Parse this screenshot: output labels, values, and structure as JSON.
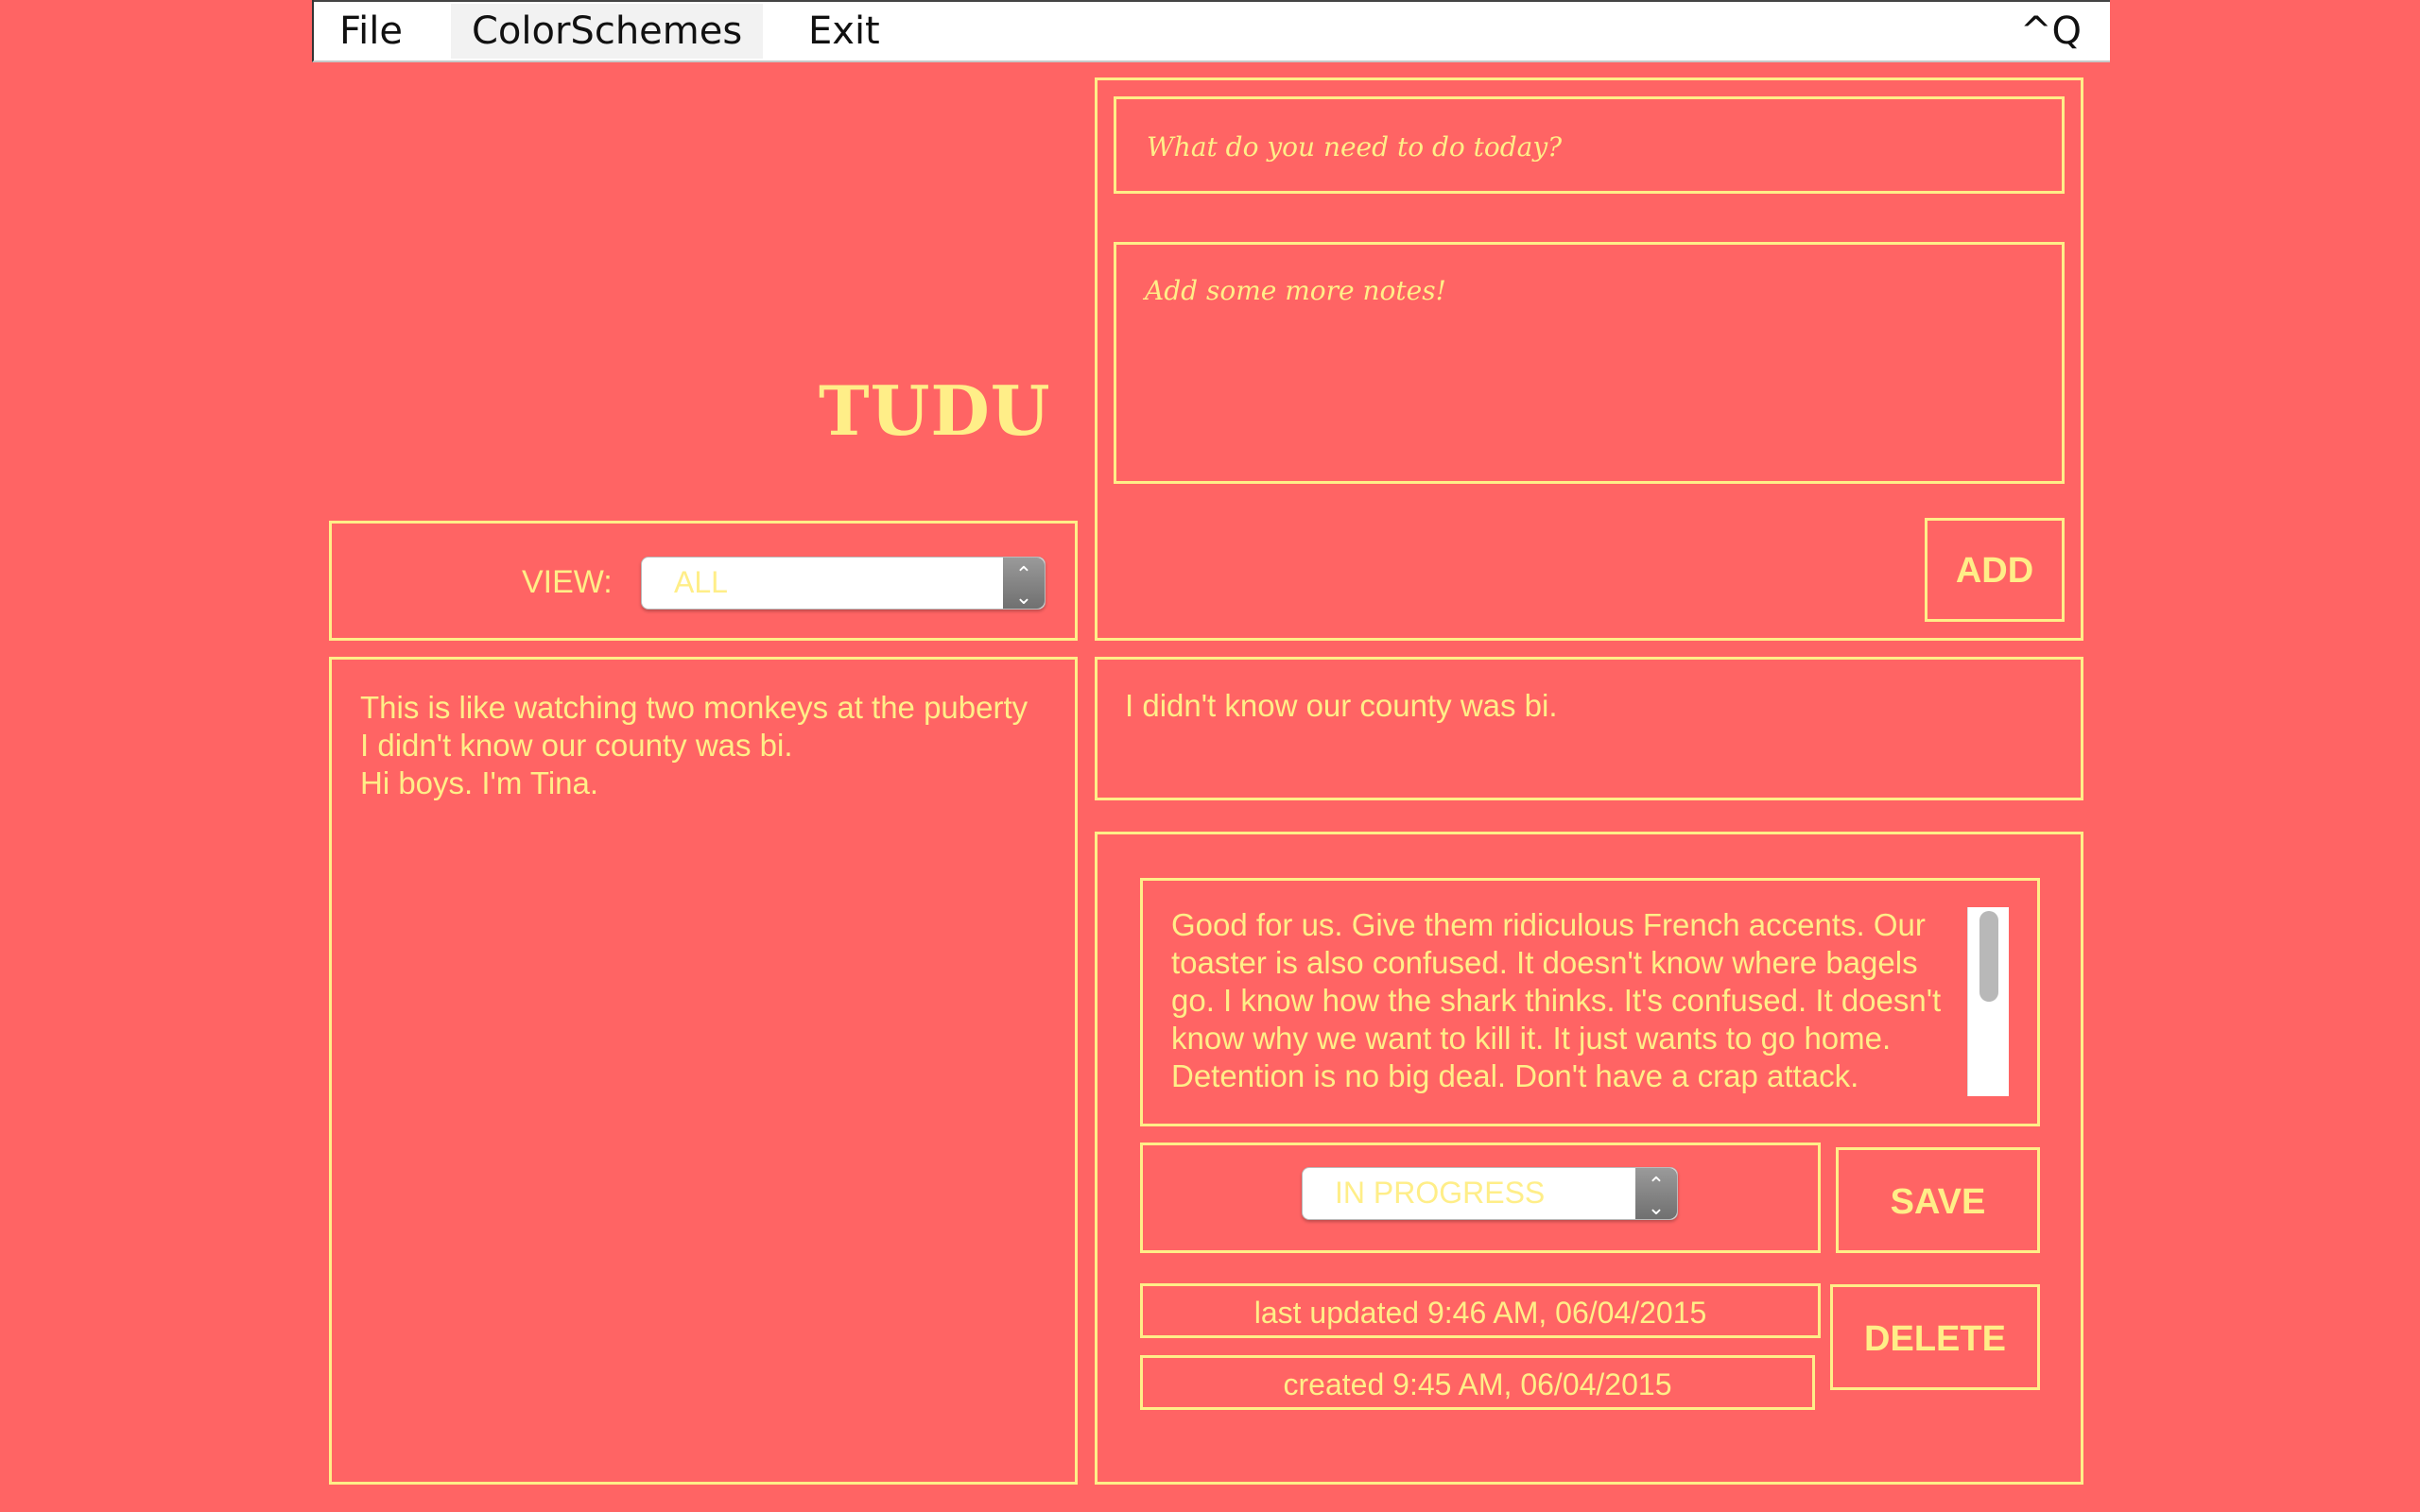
{
  "menu": {
    "file": "File",
    "colorschemes": "ColorSchemes",
    "exit": "Exit",
    "quit_shortcut": "^Q"
  },
  "app_title": "TUDU",
  "view": {
    "label": "VIEW:",
    "selected": "ALL"
  },
  "task_list": [
    "This is like watching two monkeys at the puberty",
    "I didn't know our county was bi.",
    "Hi boys. I'm Tina."
  ],
  "new_task": {
    "title_placeholder": "What do you need to do today?",
    "notes_placeholder": "Add some more notes!",
    "add_label": "ADD"
  },
  "selected_task": {
    "title": "I didn't know our county was bi.",
    "notes_lines": [
      "Good for us. Give them ridiculous French accents. Our",
      "toaster is also confused. It doesn't know where bagels",
      "go. I know how the shark thinks. It's confused. It doesn't",
      "know why we want to kill it. It just wants to go home.",
      "Detention is no big deal. Don't have a crap attack."
    ],
    "status": "IN PROGRESS",
    "save_label": "SAVE",
    "delete_label": "DELETE",
    "last_updated": "last updated 9:46 AM, 06/04/2015",
    "created": "created 9:45 AM, 06/04/2015"
  },
  "colors": {
    "background": "#ff6464",
    "accent": "#ffee88"
  }
}
